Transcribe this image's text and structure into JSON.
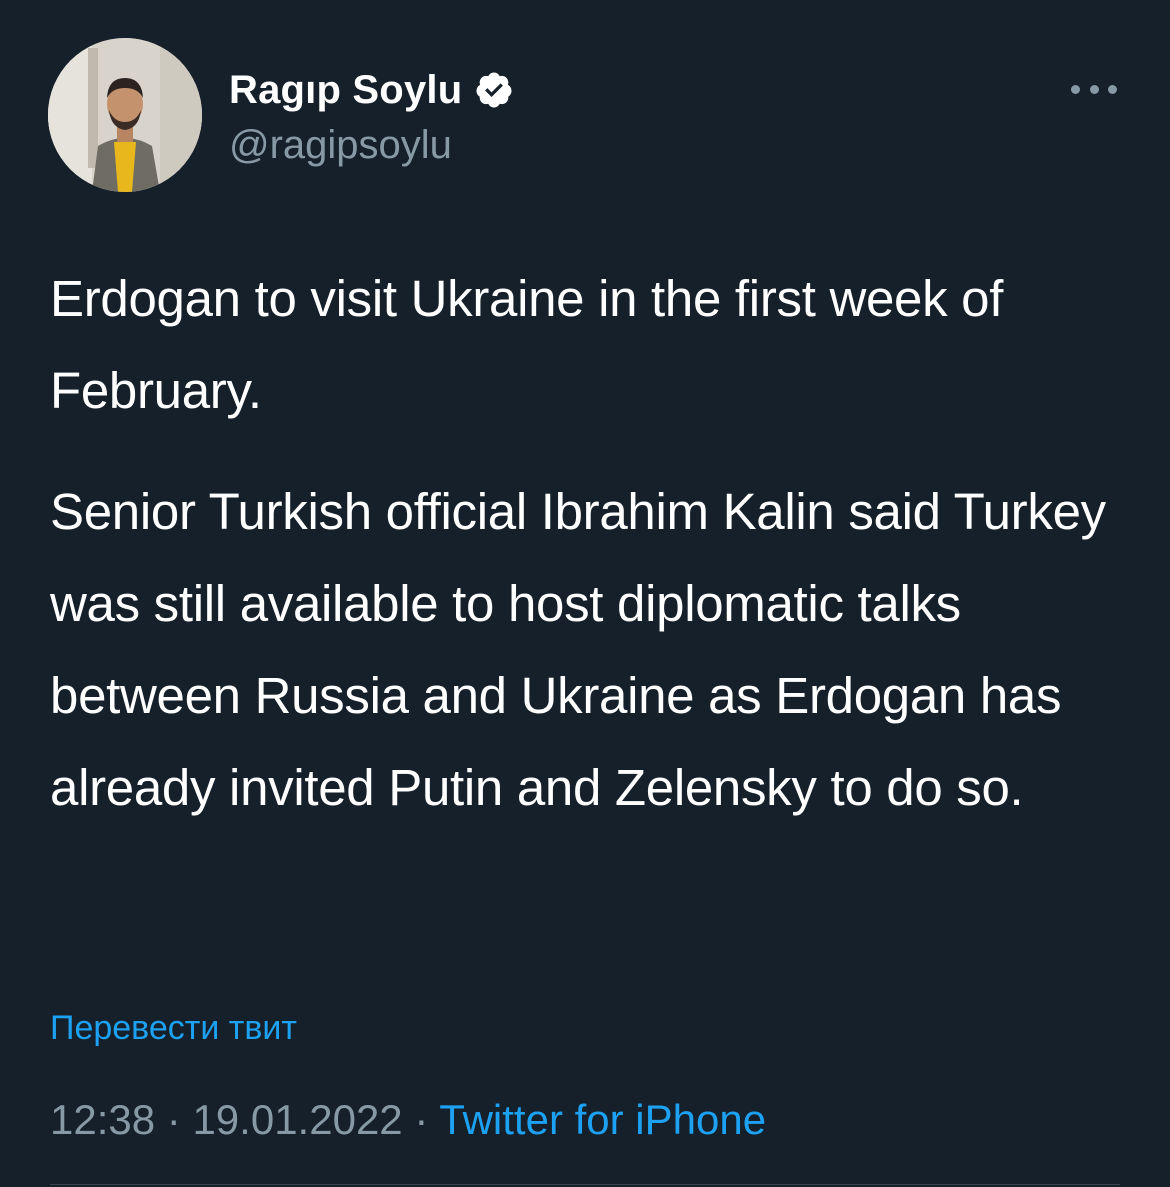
{
  "author": {
    "display_name": "Ragıp Soylu",
    "handle": "@ragipsoylu",
    "verified": true,
    "avatar_icon": "profile-photo"
  },
  "tweet": {
    "paragraphs": [
      "Erdogan to visit Ukraine in the first week of February.",
      "Senior Turkish official Ibrahim Kalin said Turkey was still available to host diplomatic talks between Russia and Ukraine as Erdogan has already invited Putin and Zelensky to do so."
    ],
    "translate_label": "Перевести твит",
    "time": "12:38",
    "date": "19.01.2022",
    "separator": "·",
    "source": "Twitter for iPhone"
  },
  "icons": {
    "more": "more-horizontal-icon",
    "verified": "verified-badge-icon"
  },
  "colors": {
    "background": "#15202b",
    "text": "#ffffff",
    "secondary": "#8899a6",
    "accent": "#1da1f2"
  }
}
